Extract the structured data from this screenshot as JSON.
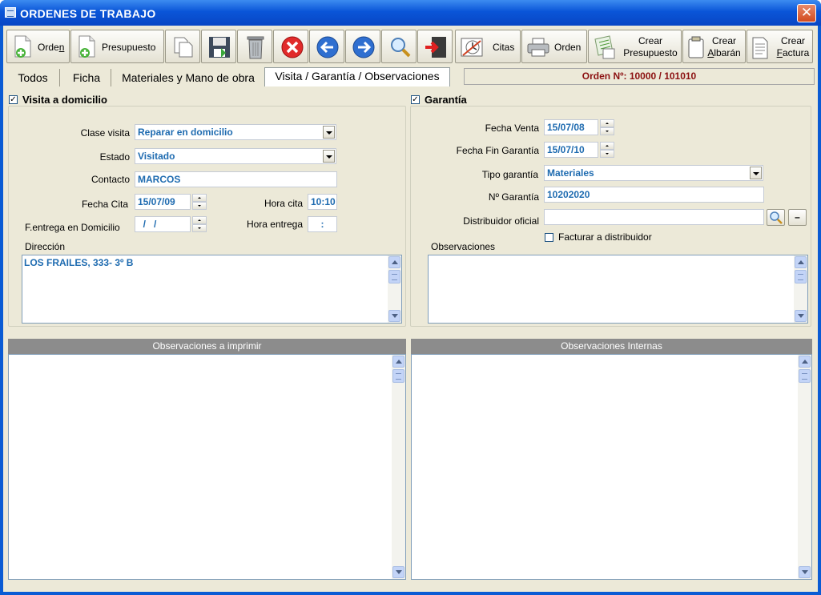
{
  "window": {
    "title": "ORDENES DE TRABAJO",
    "close_label": "✕"
  },
  "toolbar": {
    "orden": {
      "pre": "Orde",
      "post": "n",
      "underline": "n"
    },
    "presupuesto": "Presupuesto",
    "citas": "Citas",
    "imprimir_orden": "Orden",
    "crear_presupuesto": {
      "line1": "Crear",
      "line2": "Presupuesto"
    },
    "crear_albaran": {
      "line1": "Crear",
      "pre": "",
      "u": "A",
      "post": "lbarán"
    },
    "crear_factura": {
      "line1": "Crear",
      "pre": "",
      "u": "F",
      "post": "actura"
    },
    "icons": [
      "new-order-icon",
      "new-budget-icon",
      "copy-icon",
      "save-icon",
      "trash-icon",
      "delete-icon",
      "back-arrow-icon",
      "forward-arrow-icon",
      "search-icon",
      "exit-icon",
      "appointments-icon",
      "printer-icon",
      "create-budget-icon",
      "create-delivery-note-icon",
      "create-invoice-icon"
    ]
  },
  "tabs": [
    "Todos",
    "Ficha",
    "Materiales y Mano de obra",
    "Visita / Garantía / Observaciones"
  ],
  "active_tab": "Visita / Garantía / Observaciones",
  "order_number": "Orden Nº: 10000 / 101010",
  "visita": {
    "header": "Visita a domicilio",
    "checked_mark": "✓",
    "clase_visita_label": "Clase visita",
    "clase_visita": "Reparar en domicilio",
    "estado_label": "Estado",
    "estado": "Visitado",
    "contacto_label": "Contacto",
    "contacto": "MARCOS",
    "fecha_cita_label": "Fecha Cita",
    "fecha_cita": "15/07/09",
    "hora_cita_label": "Hora cita",
    "hora_cita": "10:10",
    "entrega_label": "F.entrega en Domicilio",
    "entrega": "  /   /",
    "hora_entrega_label": "Hora entrega",
    "hora_entrega": ":",
    "direccion_label": "Dirección",
    "direccion": "LOS FRAILES, 333- 3º B"
  },
  "garantia": {
    "header": "Garantía",
    "checked_mark": "✓",
    "fecha_venta_label": "Fecha Venta",
    "fecha_venta": "15/07/08",
    "fecha_fin_label": "Fecha Fin Garantía",
    "fecha_fin": "15/07/10",
    "tipo_label": "Tipo garantía",
    "tipo": "Materiales",
    "numero_label": "Nº Garantía",
    "numero": "10202020",
    "distribuidor_label": "Distribuidor oficial",
    "distribuidor": "",
    "clear_label": "–",
    "facturar_label": "Facturar a distribuidor",
    "observaciones_label": "Observaciones"
  },
  "obs_imprimir": "Observaciones a imprimir",
  "obs_internas": "Observaciones Internas",
  "colors": {
    "title_bar": "#0a55d8",
    "client_bg": "#ece9d8",
    "value_text": "#1e6bb0",
    "order_text": "#8b1010",
    "header_grey": "#8c8c8c"
  }
}
